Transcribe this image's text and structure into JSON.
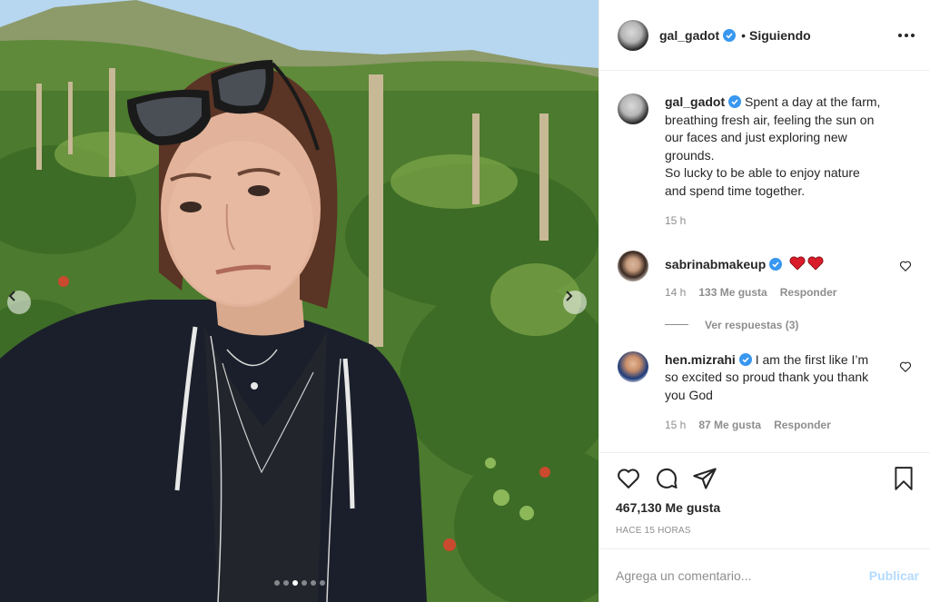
{
  "post": {
    "photo_dots": 6,
    "active_dot": 3
  },
  "header": {
    "username": "gal_gadot",
    "separator": "•",
    "follow_label": "Siguiendo"
  },
  "caption": {
    "username": "gal_gadot",
    "text_line1": "Spent a day at the farm, breathing fresh air, feeling the sun on our faces and just exploring new grounds.",
    "text_line2": "So lucky to be able to enjoy nature and spend time together.",
    "time": "15 h"
  },
  "comments": [
    {
      "username": "sabrinabmakeup",
      "text": "",
      "time": "14 h",
      "likes": "133 Me gusta",
      "reply_label": "Responder",
      "view_replies": "Ver respuestas (3)"
    },
    {
      "username": "hen.mizrahi",
      "text": "I am the first like I’m so excited so proud thank you thank you God",
      "time": "15 h",
      "likes": "87 Me gusta",
      "reply_label": "Responder"
    }
  ],
  "actions": {
    "likes": "467,130 Me gusta",
    "posted_ago": "HACE 15 HORAS"
  },
  "add_comment": {
    "placeholder": "Agrega un comentario...",
    "post_label": "Publicar"
  },
  "colors": {
    "verified": "#3897f0",
    "heart": "#ed4956",
    "publish_disabled": "#b3dbff",
    "muted": "#8e8e8e"
  },
  "icons": [
    "verified-badge-icon",
    "more-options-icon",
    "heart-icon",
    "comment-icon",
    "share-icon",
    "bookmark-icon",
    "chevron-left-icon",
    "chevron-right-icon",
    "red-heart-emoji-icon"
  ]
}
